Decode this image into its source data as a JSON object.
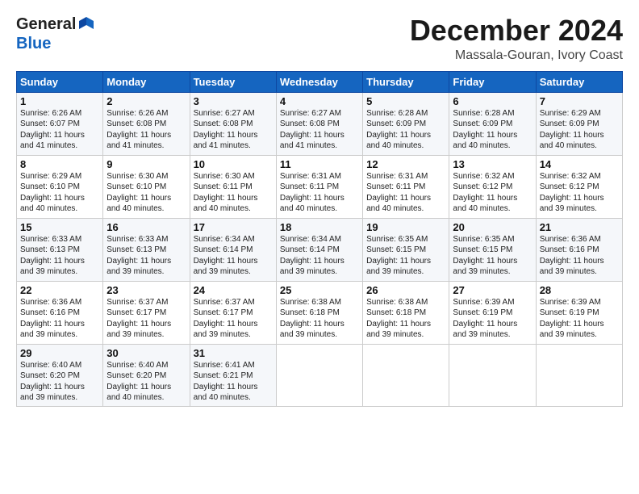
{
  "header": {
    "logo": {
      "line1": "General",
      "line2": "Blue",
      "flag_color": "#1565c0"
    },
    "title": "December 2024",
    "location": "Massala-Gouran, Ivory Coast"
  },
  "days_of_week": [
    "Sunday",
    "Monday",
    "Tuesday",
    "Wednesday",
    "Thursday",
    "Friday",
    "Saturday"
  ],
  "weeks": [
    [
      {
        "day": 1,
        "sunrise": "6:26 AM",
        "sunset": "6:07 PM",
        "daylight": "11 hours and 41 minutes."
      },
      {
        "day": 2,
        "sunrise": "6:26 AM",
        "sunset": "6:08 PM",
        "daylight": "11 hours and 41 minutes."
      },
      {
        "day": 3,
        "sunrise": "6:27 AM",
        "sunset": "6:08 PM",
        "daylight": "11 hours and 41 minutes."
      },
      {
        "day": 4,
        "sunrise": "6:27 AM",
        "sunset": "6:08 PM",
        "daylight": "11 hours and 41 minutes."
      },
      {
        "day": 5,
        "sunrise": "6:28 AM",
        "sunset": "6:09 PM",
        "daylight": "11 hours and 40 minutes."
      },
      {
        "day": 6,
        "sunrise": "6:28 AM",
        "sunset": "6:09 PM",
        "daylight": "11 hours and 40 minutes."
      },
      {
        "day": 7,
        "sunrise": "6:29 AM",
        "sunset": "6:09 PM",
        "daylight": "11 hours and 40 minutes."
      }
    ],
    [
      {
        "day": 8,
        "sunrise": "6:29 AM",
        "sunset": "6:10 PM",
        "daylight": "11 hours and 40 minutes."
      },
      {
        "day": 9,
        "sunrise": "6:30 AM",
        "sunset": "6:10 PM",
        "daylight": "11 hours and 40 minutes."
      },
      {
        "day": 10,
        "sunrise": "6:30 AM",
        "sunset": "6:11 PM",
        "daylight": "11 hours and 40 minutes."
      },
      {
        "day": 11,
        "sunrise": "6:31 AM",
        "sunset": "6:11 PM",
        "daylight": "11 hours and 40 minutes."
      },
      {
        "day": 12,
        "sunrise": "6:31 AM",
        "sunset": "6:11 PM",
        "daylight": "11 hours and 40 minutes."
      },
      {
        "day": 13,
        "sunrise": "6:32 AM",
        "sunset": "6:12 PM",
        "daylight": "11 hours and 40 minutes."
      },
      {
        "day": 14,
        "sunrise": "6:32 AM",
        "sunset": "6:12 PM",
        "daylight": "11 hours and 39 minutes."
      }
    ],
    [
      {
        "day": 15,
        "sunrise": "6:33 AM",
        "sunset": "6:13 PM",
        "daylight": "11 hours and 39 minutes."
      },
      {
        "day": 16,
        "sunrise": "6:33 AM",
        "sunset": "6:13 PM",
        "daylight": "11 hours and 39 minutes."
      },
      {
        "day": 17,
        "sunrise": "6:34 AM",
        "sunset": "6:14 PM",
        "daylight": "11 hours and 39 minutes."
      },
      {
        "day": 18,
        "sunrise": "6:34 AM",
        "sunset": "6:14 PM",
        "daylight": "11 hours and 39 minutes."
      },
      {
        "day": 19,
        "sunrise": "6:35 AM",
        "sunset": "6:15 PM",
        "daylight": "11 hours and 39 minutes."
      },
      {
        "day": 20,
        "sunrise": "6:35 AM",
        "sunset": "6:15 PM",
        "daylight": "11 hours and 39 minutes."
      },
      {
        "day": 21,
        "sunrise": "6:36 AM",
        "sunset": "6:16 PM",
        "daylight": "11 hours and 39 minutes."
      }
    ],
    [
      {
        "day": 22,
        "sunrise": "6:36 AM",
        "sunset": "6:16 PM",
        "daylight": "11 hours and 39 minutes."
      },
      {
        "day": 23,
        "sunrise": "6:37 AM",
        "sunset": "6:17 PM",
        "daylight": "11 hours and 39 minutes."
      },
      {
        "day": 24,
        "sunrise": "6:37 AM",
        "sunset": "6:17 PM",
        "daylight": "11 hours and 39 minutes."
      },
      {
        "day": 25,
        "sunrise": "6:38 AM",
        "sunset": "6:18 PM",
        "daylight": "11 hours and 39 minutes."
      },
      {
        "day": 26,
        "sunrise": "6:38 AM",
        "sunset": "6:18 PM",
        "daylight": "11 hours and 39 minutes."
      },
      {
        "day": 27,
        "sunrise": "6:39 AM",
        "sunset": "6:19 PM",
        "daylight": "11 hours and 39 minutes."
      },
      {
        "day": 28,
        "sunrise": "6:39 AM",
        "sunset": "6:19 PM",
        "daylight": "11 hours and 39 minutes."
      }
    ],
    [
      {
        "day": 29,
        "sunrise": "6:40 AM",
        "sunset": "6:20 PM",
        "daylight": "11 hours and 39 minutes."
      },
      {
        "day": 30,
        "sunrise": "6:40 AM",
        "sunset": "6:20 PM",
        "daylight": "11 hours and 40 minutes."
      },
      {
        "day": 31,
        "sunrise": "6:41 AM",
        "sunset": "6:21 PM",
        "daylight": "11 hours and 40 minutes."
      },
      null,
      null,
      null,
      null
    ]
  ]
}
